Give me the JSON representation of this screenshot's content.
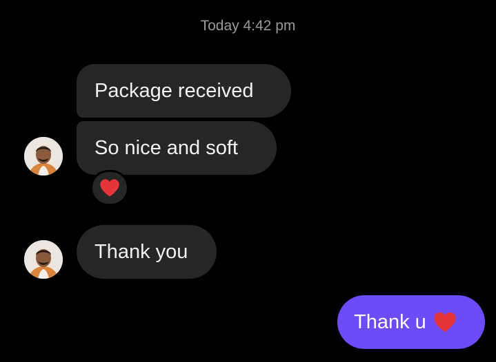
{
  "conversation": {
    "timestamp": "Today 4:42 pm",
    "incoming": [
      {
        "text": "Package received"
      },
      {
        "text": "So nice and soft"
      },
      {
        "text": "Thank you"
      }
    ],
    "reaction": {
      "icon": "red-heart-icon"
    },
    "outgoing": [
      {
        "text": "Thank u",
        "icon": "red-heart-icon"
      }
    ]
  },
  "colors": {
    "background": "#000000",
    "incoming_bubble": "#262626",
    "outgoing_bubble": "#6b4cf6",
    "timestamp_text": "#9a9a9a",
    "heart": "#e5343a"
  }
}
